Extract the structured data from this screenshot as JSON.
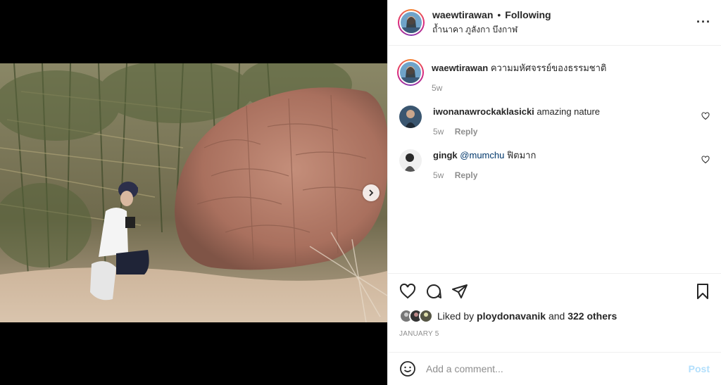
{
  "header": {
    "username": "waewtirawan",
    "separator": "•",
    "follow_status": "Following",
    "location": "ถ้ำนาคา ภูลังกา บึงกาฬ",
    "more_icon": "more-horizontal-icon"
  },
  "caption": {
    "username": "waewtirawan",
    "text": "ความมหัศจรรย์ของธรรมชาติ",
    "time": "5w"
  },
  "comments": [
    {
      "username": "iwonanawrockaklasicki",
      "mention": "",
      "text": "amazing nature",
      "time": "5w",
      "reply": "Reply"
    },
    {
      "username": "gingk",
      "mention": "@mumchu",
      "text": "ฟิตมาก",
      "time": "5w",
      "reply": "Reply"
    }
  ],
  "likes": {
    "prefix": "Liked by",
    "user": "ploydonavanik",
    "and": "and",
    "others": "322 others"
  },
  "date": "JANUARY 5",
  "add_comment": {
    "placeholder": "Add a comment...",
    "post_label": "Post"
  },
  "colors": {
    "link": "#00376b",
    "muted": "#8e8e8e",
    "post_disabled": "#b2dffc"
  }
}
